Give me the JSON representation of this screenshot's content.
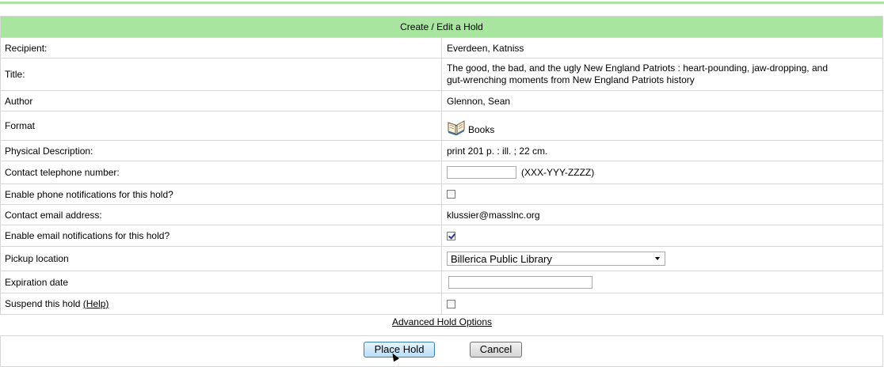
{
  "form": {
    "header": "Create / Edit a Hold",
    "rows": {
      "recipient": {
        "label": "Recipient:",
        "value": "Everdeen, Katniss"
      },
      "title": {
        "label": "Title:",
        "value": "The good, the bad, and the ugly New England Patriots : heart-pounding, jaw-dropping, and gut-wrenching moments from New England Patriots history"
      },
      "author": {
        "label": "Author",
        "value": "Glennon, Sean"
      },
      "format": {
        "label": "Format",
        "value": "Books",
        "icon": "book-icon"
      },
      "physical": {
        "label": "Physical Description:",
        "value": "print 201 p. : ill. ; 22 cm."
      },
      "phone": {
        "label": "Contact telephone number:",
        "value": "",
        "hint": "(XXX-YYY-ZZZZ)"
      },
      "phone_notify": {
        "label": "Enable phone notifications for this hold?",
        "checked": false
      },
      "email": {
        "label": "Contact email address:",
        "value": "klussier@masslnc.org"
      },
      "email_notify": {
        "label": "Enable email notifications for this hold?",
        "checked": true
      },
      "pickup": {
        "label": "Pickup location",
        "selected": "Billerica Public Library"
      },
      "expiration": {
        "label": "Expiration date",
        "value": ""
      },
      "suspend": {
        "label": "Suspend this hold",
        "help": "(Help)",
        "checked": false
      }
    }
  },
  "advanced_link": "Advanced Hold Options",
  "buttons": {
    "place_hold": "Place Hold",
    "cancel": "Cancel"
  }
}
